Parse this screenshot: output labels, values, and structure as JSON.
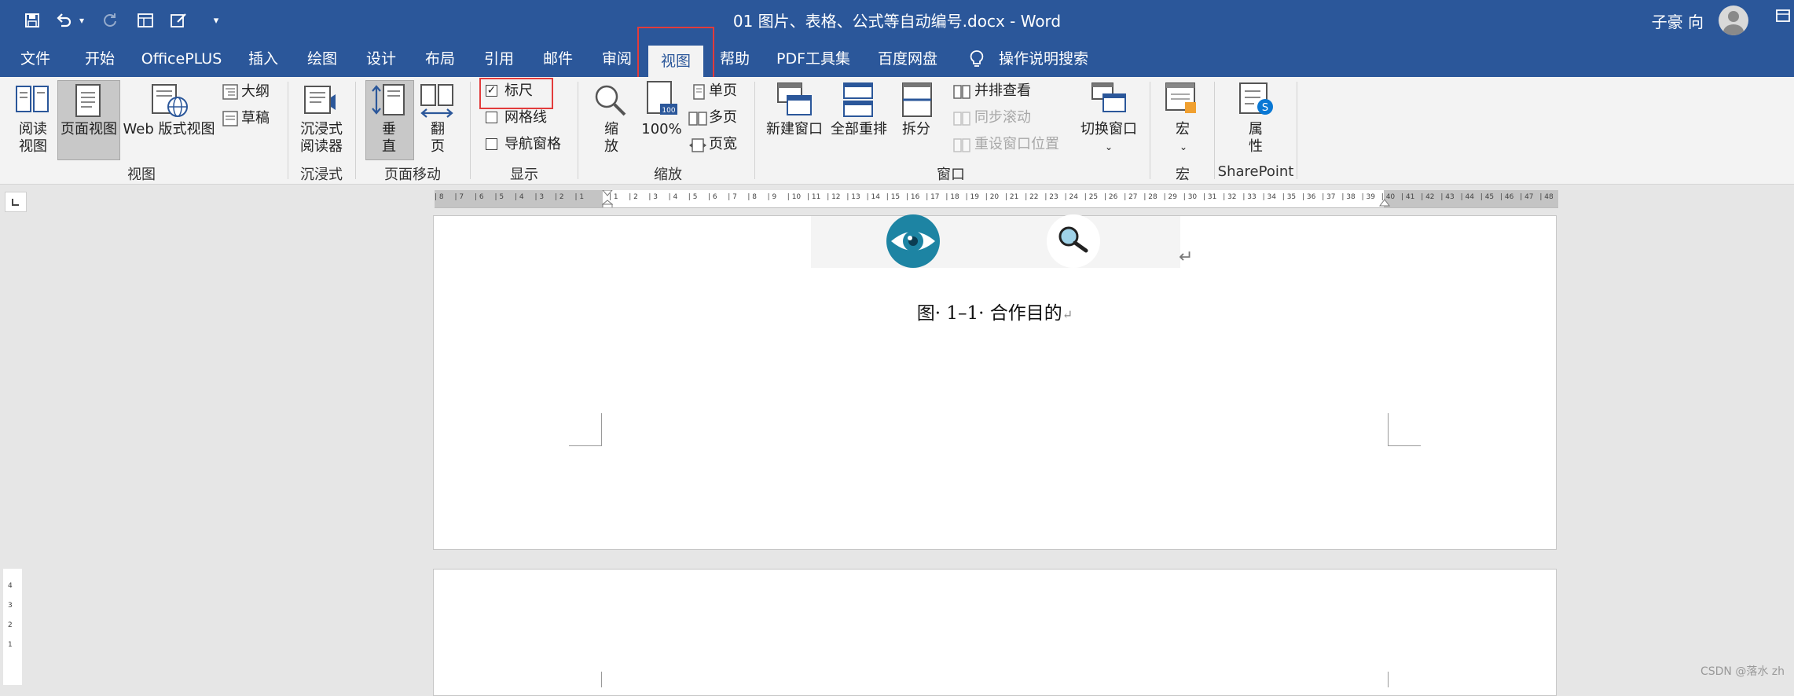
{
  "window": {
    "title": "01 图片、表格、公式等自动编号.docx  -  Word",
    "user": "子豪 向"
  },
  "qat": {
    "save": "save-icon",
    "undo": "undo-icon",
    "redo": "redo-icon",
    "more": "▾"
  },
  "tabs": [
    "文件",
    "开始",
    "OfficePLUS",
    "插入",
    "绘图",
    "设计",
    "布局",
    "引用",
    "邮件",
    "审阅",
    "视图",
    "帮助",
    "PDF工具集",
    "百度网盘",
    "操作说明搜索"
  ],
  "active_tab": "视图",
  "ribbon": {
    "views": {
      "label": "视图",
      "read_mode": [
        "阅读",
        "视图"
      ],
      "print_layout": "页面视图",
      "web_layout": "Web 版式视图",
      "outline": "大纲",
      "draft": "草稿"
    },
    "immersive": {
      "label": "沉浸式",
      "reader": [
        "沉浸式",
        "阅读器"
      ]
    },
    "page_movement": {
      "label": "页面移动",
      "vertical": [
        "垂",
        "直"
      ],
      "side_to_side": [
        "翻",
        "页"
      ]
    },
    "show": {
      "label": "显示",
      "ruler": "标尺",
      "ruler_checked": true,
      "gridlines": "网格线",
      "nav_pane": "导航窗格"
    },
    "zoom": {
      "label": "缩放",
      "zoom": [
        "缩",
        "放"
      ],
      "hundred": "100%",
      "one_page": "单页",
      "multi_page": "多页",
      "page_width": "页宽"
    },
    "window": {
      "label": "窗口",
      "new_window": "新建窗口",
      "arrange_all": "全部重排",
      "split": "拆分",
      "side_by_side": "并排查看",
      "sync_scroll": "同步滚动",
      "reset_pos": "重设窗口位置",
      "switch_windows": "切换窗口"
    },
    "macros": {
      "label": "宏",
      "macros": "宏"
    },
    "sharepoint": {
      "label": "SharePoint",
      "properties": [
        "属",
        "性"
      ]
    }
  },
  "ruler": {
    "left_ticks": [
      "8",
      "7",
      "6",
      "5",
      "4",
      "3",
      "2",
      "1"
    ],
    "right_ticks": [
      "1",
      "2",
      "3",
      "4",
      "5",
      "6",
      "7",
      "8",
      "9",
      "10",
      "11",
      "12",
      "13",
      "14",
      "15",
      "16",
      "17",
      "18",
      "19",
      "20",
      "21",
      "22",
      "23",
      "24",
      "25",
      "26",
      "27",
      "28",
      "29",
      "30",
      "31",
      "32",
      "33",
      "34",
      "35",
      "36",
      "37",
      "38",
      "39",
      "40",
      "41",
      "42",
      "43",
      "44",
      "45",
      "46",
      "47",
      "48"
    ],
    "vertical_ticks": [
      "4",
      "3",
      "2",
      "1"
    ]
  },
  "document": {
    "caption": "图· 1–1· 合作目的",
    "caption_mark": "↵",
    "image_mark": "↵"
  },
  "watermark": "CSDN @落水 zh",
  "colors": {
    "brand": "#2b579a",
    "highlight_box": "#e23b3b",
    "eye_icon": "#1d84a3"
  }
}
